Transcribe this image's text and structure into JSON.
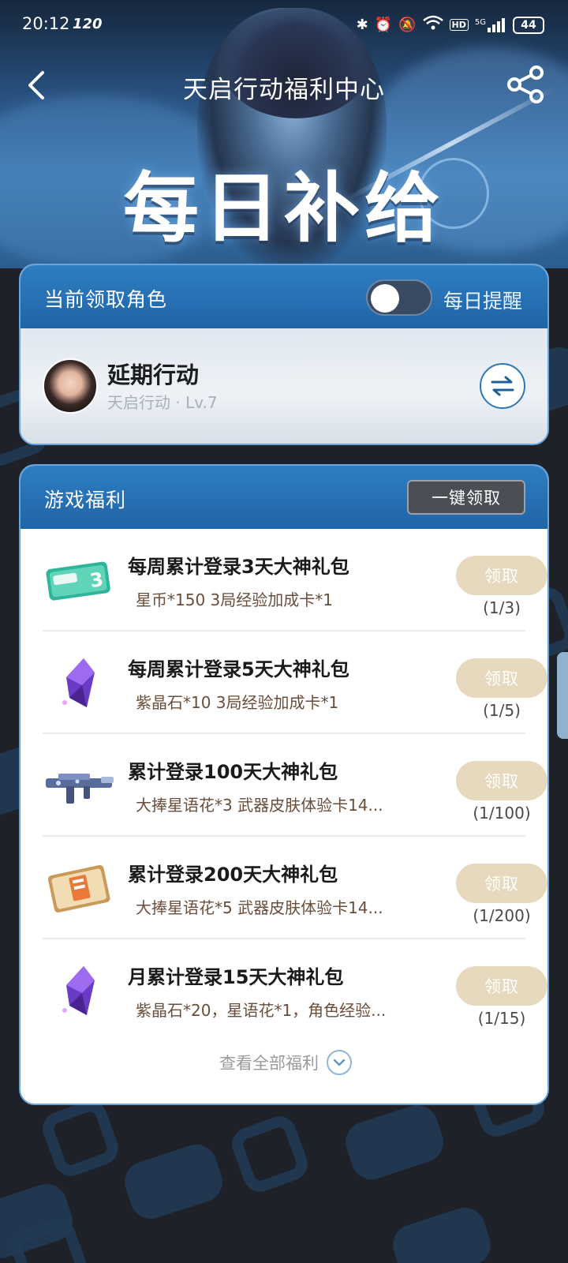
{
  "status_bar": {
    "time": "20:12",
    "refresh_rate": "120",
    "network": "5G",
    "hd": "HD",
    "battery": "44"
  },
  "nav": {
    "title": "天启行动福利中心"
  },
  "hero": {
    "title": "每日补给"
  },
  "role_card": {
    "title": "当前领取角色",
    "reminder_label": "每日提醒",
    "reminder_on": false,
    "role_name": "延期行动",
    "role_sub": "天启行动 · Lv.7"
  },
  "benefit_card": {
    "title": "游戏福利",
    "claim_all": "一键领取",
    "view_all": "查看全部福利",
    "items": [
      {
        "title": "每周累计登录3天大神礼包",
        "desc": "星币*150 3局经验加成卡*1",
        "button": "领取",
        "progress": "(1/3)",
        "icon": "exp-card-icon"
      },
      {
        "title": "每周累计登录5天大神礼包",
        "desc": "紫晶石*10 3局经验加成卡*1",
        "button": "领取",
        "progress": "(1/5)",
        "icon": "purple-crystal-icon"
      },
      {
        "title": "累计登录100天大神礼包",
        "desc": "大捧星语花*3 武器皮肤体验卡14...",
        "button": "领取",
        "progress": "(1/100)",
        "icon": "rifle-skin-icon"
      },
      {
        "title": "累计登录200天大神礼包",
        "desc": "大捧星语花*5 武器皮肤体验卡14...",
        "button": "领取",
        "progress": "(1/200)",
        "icon": "supply-box-icon"
      },
      {
        "title": "月累计登录15天大神礼包",
        "desc": "紫晶石*20，星语花*1，角色经验...",
        "button": "领取",
        "progress": "(1/15)",
        "icon": "purple-crystal-icon"
      }
    ]
  },
  "colors": {
    "header_blue": "#2f7ec2",
    "claim_button": "#e6d9be",
    "background": "#1e2228"
  }
}
